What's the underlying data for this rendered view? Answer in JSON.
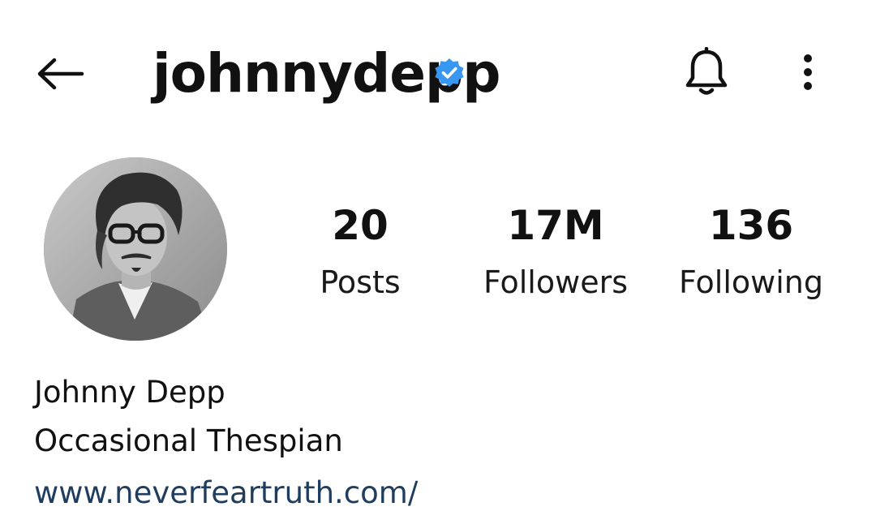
{
  "header": {
    "username": "johnnydepp",
    "back_icon": "arrow-left-icon",
    "verified_icon": "verified-badge-icon",
    "notification_icon": "bell-icon",
    "more_icon": "more-vertical-icon"
  },
  "profile": {
    "avatar_icon": "profile-photo",
    "stats": [
      {
        "value": "20",
        "label": "Posts"
      },
      {
        "value": "17M",
        "label": "Followers"
      },
      {
        "value": "136",
        "label": "Following"
      }
    ]
  },
  "bio": {
    "name": "Johnny Depp",
    "text": "Occasional Thespian",
    "link": "www.neverfeartruth.com/"
  },
  "colors": {
    "background": "#ffffff",
    "text": "#111111",
    "verified_blue": "#3897f0",
    "link": "#1f3d5e"
  }
}
